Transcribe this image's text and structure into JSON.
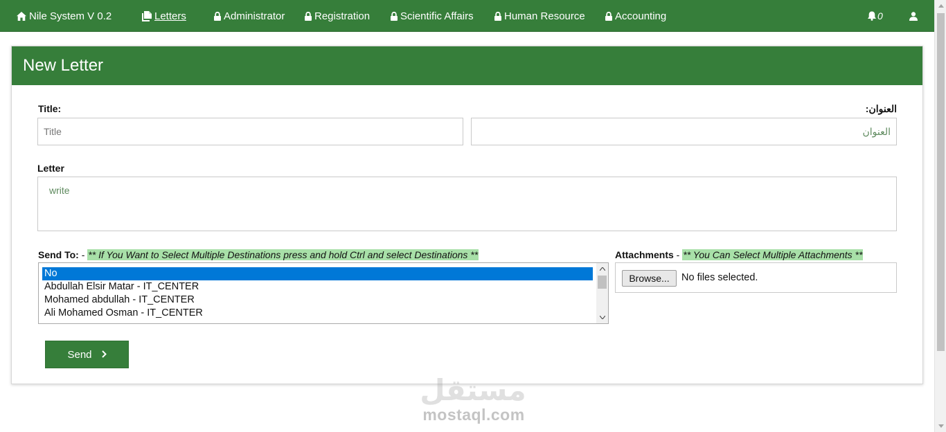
{
  "nav": {
    "brand": "Nile System V 0.2",
    "items": [
      {
        "label": "Letters"
      },
      {
        "label": "Administrator"
      },
      {
        "label": "Registration"
      },
      {
        "label": "Scientific Affairs"
      },
      {
        "label": "Human Resource"
      },
      {
        "label": "Accounting"
      }
    ],
    "notification_count": "0"
  },
  "panel": {
    "title": "New Letter"
  },
  "form": {
    "title_label": "Title:",
    "title_placeholder": "Title",
    "arabic_title_label": "العنوان:",
    "arabic_title_placeholder": "العنوان",
    "letter_label": "Letter",
    "letter_placeholder": "write",
    "send_to_label": "Send To:",
    "send_to_dash": " - ",
    "send_to_hint": "** If You Want to Select Multiple Destinations press and hold Ctrl and select Destinations **",
    "destinations": [
      "No",
      "Abdullah Elsir Matar - IT_CENTER",
      "Mohamed abdullah - IT_CENTER",
      "Ali Mohamed Osman - IT_CENTER"
    ],
    "selected_destination": "No",
    "attachments_label": "Attachments",
    "attachments_dash": " - ",
    "attachments_hint": "** You Can Select Multiple Attachments **",
    "browse_label": "Browse...",
    "no_files_text": "No files selected.",
    "send_label": "Send"
  },
  "watermark": {
    "logo_text": "مستقل",
    "url": "mostaql.com"
  },
  "colors": {
    "primary_green": "#367e3a",
    "hint_highlight": "#a8e0a8",
    "selection_blue": "#0078d7"
  },
  "icons": [
    "home-icon",
    "document-icon",
    "lock-icon",
    "bell-icon",
    "user-icon",
    "chevron-right-icon"
  ]
}
